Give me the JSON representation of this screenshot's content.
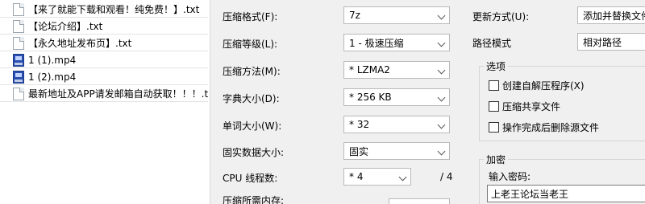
{
  "file_list": [
    {
      "name": "【来了就能下载和观看！纯免费！】.txt",
      "icon": "text-file-icon"
    },
    {
      "name": "【论坛介绍】.txt",
      "icon": "text-file-icon"
    },
    {
      "name": "【永久地址发布页】.txt",
      "icon": "text-file-icon"
    },
    {
      "name": "1 (1).mp4",
      "icon": "video-file-icon"
    },
    {
      "name": "1 (2).mp4",
      "icon": "video-file-icon"
    },
    {
      "name": "最新地址及APP请发邮箱自动获取！！！.txt",
      "icon": "text-file-icon"
    }
  ],
  "dialog": {
    "format_label": "压缩格式(F):",
    "format_value": "7z",
    "level_label": "压缩等级(L):",
    "level_value": "1 - 极速压缩",
    "method_label": "压缩方法(M):",
    "method_value": "* LZMA2",
    "dict_label": "字典大小(D):",
    "dict_value": "* 256 KB",
    "word_label": "单词大小(W):",
    "word_value": "* 32",
    "solid_label": "固实数据大小:",
    "solid_value": "固实",
    "cpu_label": "CPU 线程数:",
    "cpu_value": "* 4",
    "cpu_total": "/ 4",
    "memory_label": "压缩所需内存:",
    "update_label": "更新方式(U):",
    "update_value": "添加并替换文件",
    "path_label": "路径模式",
    "path_value": "相对路径",
    "options_title": "选项",
    "options": [
      {
        "label": "创建自解压程序(X)",
        "checked": false
      },
      {
        "label": "压缩共享文件",
        "checked": false
      },
      {
        "label": "操作完成后删除源文件",
        "checked": false
      }
    ],
    "encryption_title": "加密",
    "password_label": "输入密码:",
    "password_value": "上老王论坛当老王"
  }
}
